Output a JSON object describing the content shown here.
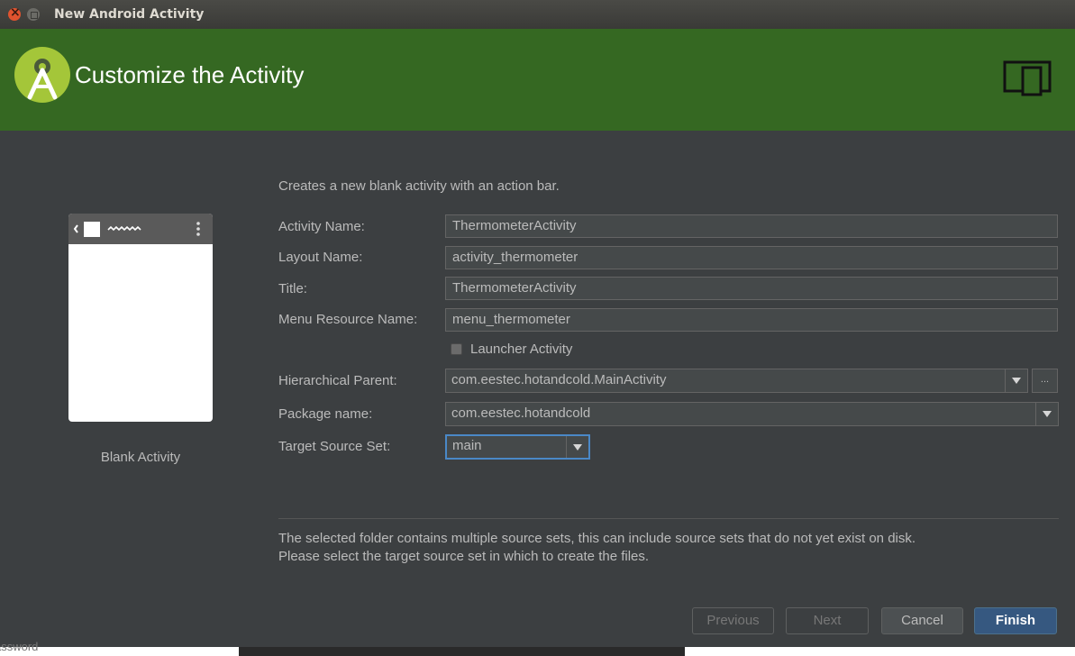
{
  "window": {
    "title": "New Android Activity"
  },
  "header": {
    "title": "Customize the Activity"
  },
  "template": {
    "name": "Blank Activity"
  },
  "form": {
    "description": "Creates a new blank activity with an action bar.",
    "activity_name": {
      "label": "Activity Name:",
      "value": "ThermometerActivity"
    },
    "layout_name": {
      "label": "Layout Name:",
      "value": "activity_thermometer"
    },
    "title": {
      "label": "Title:",
      "value": "ThermometerActivity"
    },
    "menu_resource": {
      "label": "Menu Resource Name:",
      "value": "menu_thermometer"
    },
    "launcher": {
      "label": "Launcher Activity",
      "checked": false
    },
    "hierarchical_parent": {
      "label": "Hierarchical Parent:",
      "value": "com.eestec.hotandcold.MainActivity",
      "browse_label": "..."
    },
    "package_name": {
      "label": "Package name:",
      "value": "com.eestec.hotandcold"
    },
    "source_set": {
      "label": "Target Source Set:",
      "value": "main"
    }
  },
  "hint": {
    "line1": "The selected folder contains multiple source sets, this can include source sets that do not yet exist on disk.",
    "line2": "Please select the target source set in which to create the files."
  },
  "buttons": {
    "previous": "Previous",
    "next": "Next",
    "cancel": "Cancel",
    "finish": "Finish"
  },
  "background": {
    "behind_text": "assword"
  },
  "colors": {
    "header": "#356822",
    "dialog": "#3c3f41",
    "accent": "#365880",
    "android": "#a4c639"
  }
}
